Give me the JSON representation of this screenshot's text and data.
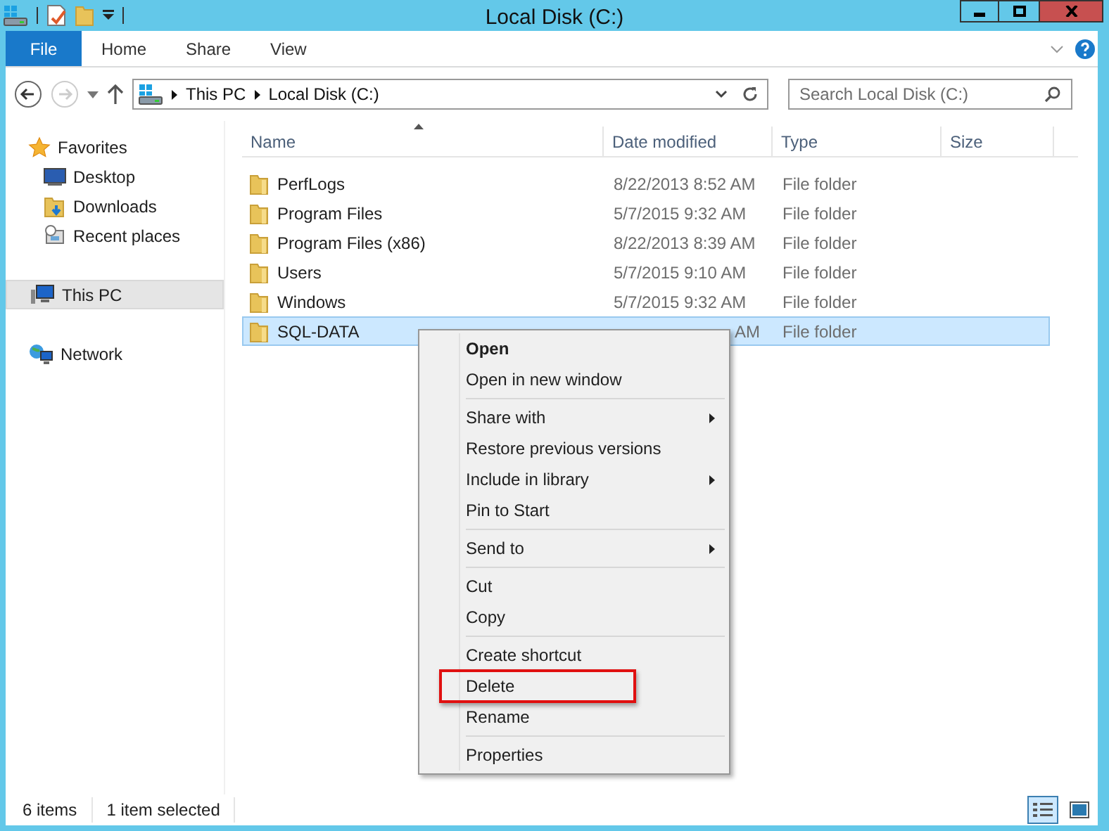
{
  "window": {
    "title": "Local Disk (C:)"
  },
  "ribbon": {
    "tabs": [
      {
        "label": "File",
        "selected": true
      },
      {
        "label": "Home",
        "selected": false
      },
      {
        "label": "Share",
        "selected": false
      },
      {
        "label": "View",
        "selected": false
      }
    ]
  },
  "address_bar": {
    "path": [
      "This PC",
      "Local Disk (C:)"
    ]
  },
  "search": {
    "placeholder": "Search Local Disk (C:)"
  },
  "sidebar": {
    "items": [
      {
        "label": "Favorites",
        "kind": "favorites",
        "selected": false,
        "children": [
          {
            "label": "Desktop",
            "kind": "desktop",
            "selected": false
          },
          {
            "label": "Downloads",
            "kind": "downloads",
            "selected": false
          },
          {
            "label": "Recent places",
            "kind": "recent",
            "selected": false
          }
        ]
      },
      {
        "label": "This PC",
        "kind": "pc",
        "selected": true
      },
      {
        "label": "Network",
        "kind": "network",
        "selected": false
      }
    ]
  },
  "table": {
    "columns": [
      "Name",
      "Date modified",
      "Type",
      "Size"
    ],
    "rows": [
      {
        "name": "PerfLogs",
        "date": "8/22/2013 8:52 AM",
        "type": "File folder",
        "selected": false,
        "date_covered": false
      },
      {
        "name": "Program Files",
        "date": "5/7/2015 9:32 AM",
        "type": "File folder",
        "selected": false,
        "date_covered": false
      },
      {
        "name": "Program Files (x86)",
        "date": "8/22/2013 8:39 AM",
        "type": "File folder",
        "selected": false,
        "date_covered": false
      },
      {
        "name": "Users",
        "date": "5/7/2015 9:10 AM",
        "type": "File folder",
        "selected": false,
        "date_covered": false
      },
      {
        "name": "Windows",
        "date": "5/7/2015 9:32 AM",
        "type": "File folder",
        "selected": false,
        "date_covered": false
      },
      {
        "name": "SQL-DATA",
        "date": "AM",
        "type": "File folder",
        "selected": true,
        "date_covered": true
      }
    ]
  },
  "context_menu": {
    "items": [
      {
        "kind": "item",
        "label": "Open",
        "bold": true,
        "submenu": false,
        "highlighted": false
      },
      {
        "kind": "item",
        "label": "Open in new window",
        "bold": false,
        "submenu": false,
        "highlighted": false
      },
      {
        "kind": "separator"
      },
      {
        "kind": "item",
        "label": "Share with",
        "bold": false,
        "submenu": true,
        "highlighted": false
      },
      {
        "kind": "item",
        "label": "Restore previous versions",
        "bold": false,
        "submenu": false,
        "highlighted": false
      },
      {
        "kind": "item",
        "label": "Include in library",
        "bold": false,
        "submenu": true,
        "highlighted": false
      },
      {
        "kind": "item",
        "label": "Pin to Start",
        "bold": false,
        "submenu": false,
        "highlighted": false
      },
      {
        "kind": "separator"
      },
      {
        "kind": "item",
        "label": "Send to",
        "bold": false,
        "submenu": true,
        "highlighted": false
      },
      {
        "kind": "separator"
      },
      {
        "kind": "item",
        "label": "Cut",
        "bold": false,
        "submenu": false,
        "highlighted": false
      },
      {
        "kind": "item",
        "label": "Copy",
        "bold": false,
        "submenu": false,
        "highlighted": false
      },
      {
        "kind": "separator"
      },
      {
        "kind": "item",
        "label": "Create shortcut",
        "bold": false,
        "submenu": false,
        "highlighted": false
      },
      {
        "kind": "item",
        "label": "Delete",
        "bold": false,
        "submenu": false,
        "highlighted": true
      },
      {
        "kind": "item",
        "label": "Rename",
        "bold": false,
        "submenu": false,
        "highlighted": false
      },
      {
        "kind": "separator"
      },
      {
        "kind": "item",
        "label": "Properties",
        "bold": false,
        "submenu": false,
        "highlighted": false
      }
    ]
  },
  "status_bar": {
    "items": [
      "6 items",
      "1 item selected"
    ],
    "views": [
      {
        "kind": "details",
        "selected": true
      },
      {
        "kind": "large-icons",
        "selected": false
      }
    ]
  }
}
